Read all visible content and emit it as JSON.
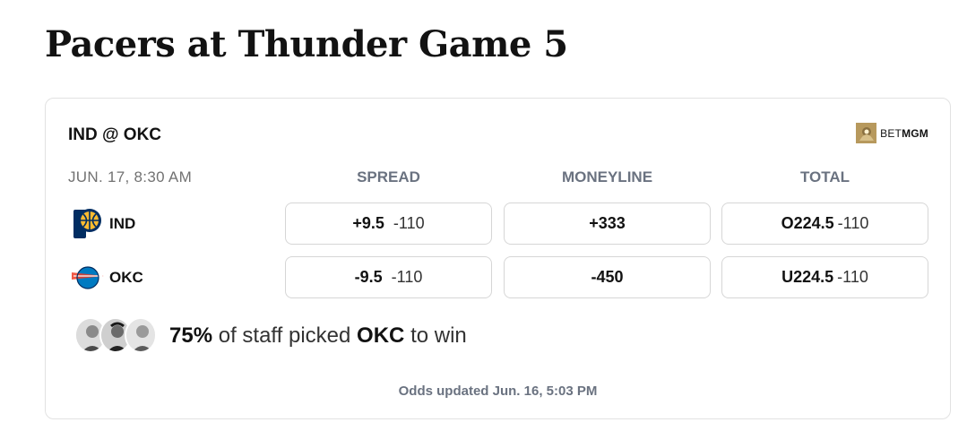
{
  "page": {
    "title": "Pacers at Thunder Game 5"
  },
  "card": {
    "matchup": "IND @ OKC",
    "sponsor": {
      "prefix": "BET",
      "name": "MGM"
    },
    "datetime": "JUN. 17, 8:30 AM",
    "columns": [
      "SPREAD",
      "MONEYLINE",
      "TOTAL"
    ],
    "teams": [
      {
        "abbr": "IND",
        "logo_icon": "pacers-logo-icon",
        "spread": {
          "line": "+9.5",
          "price": "-110"
        },
        "moneyline": "+333",
        "total": {
          "line": "O224.5",
          "price": "-110"
        }
      },
      {
        "abbr": "OKC",
        "logo_icon": "thunder-logo-icon",
        "spread": {
          "line": "-9.5",
          "price": "-110"
        },
        "moneyline": "-450",
        "total": {
          "line": "U224.5",
          "price": "-110"
        }
      }
    ],
    "staff_pick": {
      "percent": "75%",
      "text_mid": "of staff picked",
      "team": "OKC",
      "text_end": "to win"
    },
    "updated": "Odds updated Jun. 16, 5:03 PM"
  },
  "colors": {
    "ind_navy": "#002D62",
    "ind_gold": "#FDBB30",
    "okc_blue": "#007AC1",
    "okc_orange": "#EF3B24",
    "mgm_gold": "#B7995D"
  }
}
